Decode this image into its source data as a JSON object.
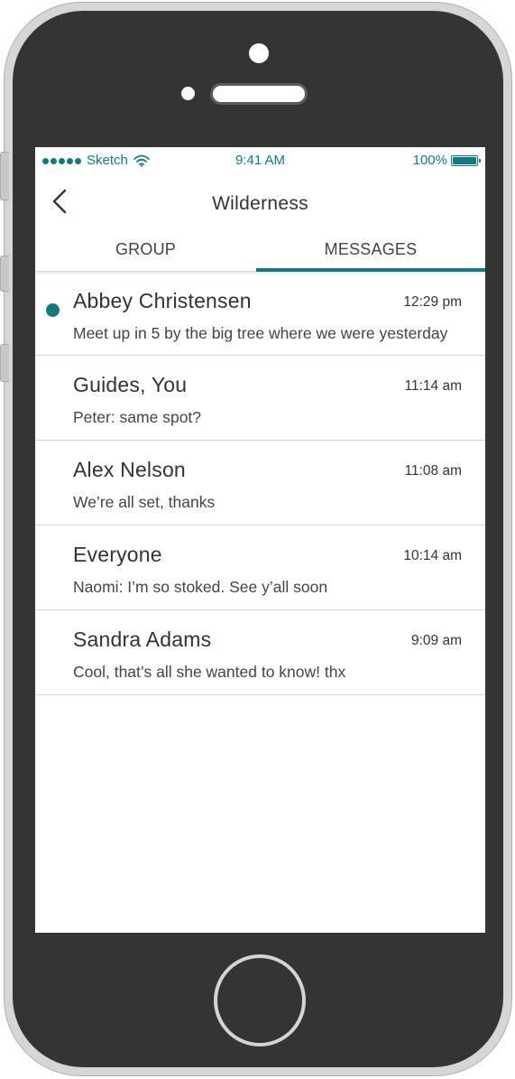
{
  "status_bar": {
    "carrier": "Sketch",
    "time": "9:41 AM",
    "battery": "100%",
    "icons": [
      "signal-dots-icon",
      "wifi-icon",
      "battery-icon"
    ]
  },
  "nav": {
    "back_icon": "chevron-left-icon",
    "title": "Wilderness"
  },
  "tabs": [
    {
      "label": "GROUP",
      "selected": false
    },
    {
      "label": "MESSAGES",
      "selected": true
    }
  ],
  "messages": [
    {
      "name": "Abbey Christensen",
      "time": "12:29 pm",
      "preview": "Meet up in 5 by the big tree where we were yesterday",
      "unread": true
    },
    {
      "name": "Guides, You",
      "time": "11:14 am",
      "preview": "Peter: same spot?",
      "unread": false
    },
    {
      "name": "Alex Nelson",
      "time": "11:08 am",
      "preview": "We’re all set, thanks",
      "unread": false
    },
    {
      "name": "Everyone",
      "time": "10:14 am",
      "preview": "Naomi: I’m so stoked. See y’all soon",
      "unread": false
    },
    {
      "name": "Sandra Adams",
      "time": "9:09 am",
      "preview": "Cool, that’s all she wanted to know! thx",
      "unread": false
    }
  ],
  "colors": {
    "accent": "#137a82",
    "phone_body": "#343434",
    "phone_frame": "#d6d6d6",
    "text": "#333333",
    "divider": "#d4d4d4"
  }
}
